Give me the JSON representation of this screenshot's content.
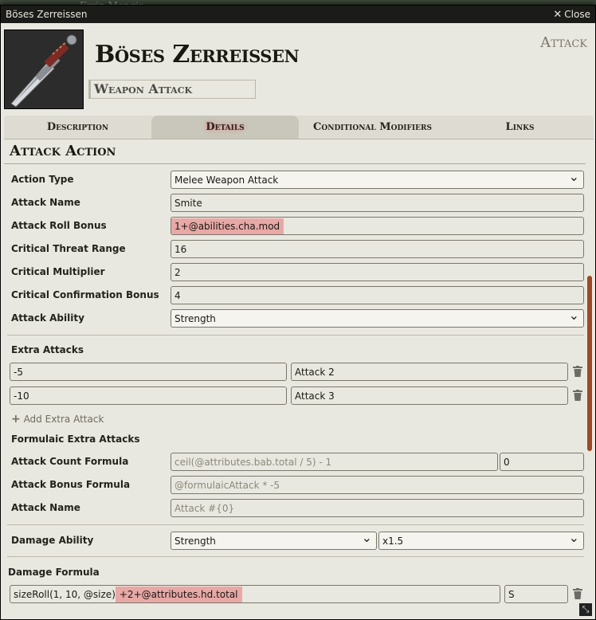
{
  "background": {
    "tab_label": "Errin Mengis"
  },
  "window": {
    "title": "Böses Zerreissen",
    "close_label": "Close"
  },
  "header": {
    "item_name": "Böses Zerreissen",
    "item_type": "Attack",
    "item_subtype": "Weapon Attack",
    "image_icon": "dagger-icon"
  },
  "tabs": [
    {
      "label": "Description",
      "active": false
    },
    {
      "label": "Details",
      "active": true
    },
    {
      "label": "Conditional Modifiers",
      "active": false
    },
    {
      "label": "Links",
      "active": false
    }
  ],
  "section": {
    "title": "Attack Action"
  },
  "fields": {
    "action_type": {
      "label": "Action Type",
      "value": "Melee Weapon Attack"
    },
    "attack_name": {
      "label": "Attack Name",
      "value": "Smite"
    },
    "attack_roll_bonus": {
      "label": "Attack Roll Bonus",
      "value": "1+@abilities.cha.mod"
    },
    "critical_threat_range": {
      "label": "Critical Threat Range",
      "value": "16"
    },
    "critical_multiplier": {
      "label": "Critical Multiplier",
      "value": "2"
    },
    "critical_confirmation_bonus": {
      "label": "Critical Confirmation Bonus",
      "value": "4"
    },
    "attack_ability": {
      "label": "Attack Ability",
      "value": "Strength"
    }
  },
  "extra_attacks": {
    "title": "Extra Attacks",
    "rows": [
      {
        "formula": "-5",
        "name": "Attack 2"
      },
      {
        "formula": "-10",
        "name": "Attack 3"
      }
    ],
    "add_label": "Add Extra Attack"
  },
  "formulaic": {
    "title": "Formulaic Extra Attacks",
    "count_label": "Attack Count Formula",
    "count_placeholder": "ceil(@attributes.bab.total / 5) - 1",
    "count_value": "0",
    "bonus_label": "Attack Bonus Formula",
    "bonus_placeholder": "@formulaicAttack * -5",
    "name_label": "Attack Name",
    "name_placeholder": "Attack #{0}"
  },
  "damage": {
    "ability_label": "Damage Ability",
    "ability_value": "Strength",
    "multiplier_value": "x1.5",
    "formula_title": "Damage Formula",
    "formula_prefix": "sizeRoll(1, 10, @size)",
    "formula_highlight": "+2+@attributes.hd.total",
    "type_value": "S"
  },
  "colors": {
    "accent": "#9b4a25",
    "highlight": "#e8a8a6"
  }
}
